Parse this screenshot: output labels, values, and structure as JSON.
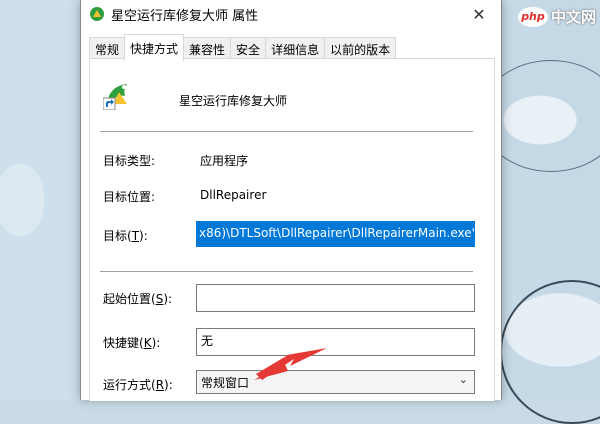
{
  "watermark": {
    "logo": "php",
    "text": "中文网"
  },
  "window": {
    "title": "星空运行库修复大师 属性",
    "close": "✕"
  },
  "tabs": [
    {
      "label": "常规"
    },
    {
      "label": "快捷方式"
    },
    {
      "label": "兼容性"
    },
    {
      "label": "安全"
    },
    {
      "label": "详细信息"
    },
    {
      "label": "以前的版本"
    }
  ],
  "app_name": "星空运行库修复大师",
  "fields": {
    "target_type_label": "目标类型:",
    "target_type_value": "应用程序",
    "target_location_label": "目标位置:",
    "target_location_value": "DllRepairer",
    "target_label": "目标(",
    "target_label_key": "T",
    "target_label_end": "):",
    "target_value": "x86)\\DTLSoft\\DllRepairer\\DllRepairerMain.exe\"",
    "start_in_label": "起始位置(",
    "start_in_key": "S",
    "start_in_end": "):",
    "start_in_value": "",
    "hotkey_label": "快捷键(",
    "hotkey_key": "K",
    "hotkey_end": "):",
    "hotkey_value": "无",
    "run_label": "运行方式(",
    "run_key": "R",
    "run_end": "):",
    "run_value": "常规窗口"
  },
  "colors": {
    "selection": "#0078d7",
    "arrow": "#e53935"
  }
}
